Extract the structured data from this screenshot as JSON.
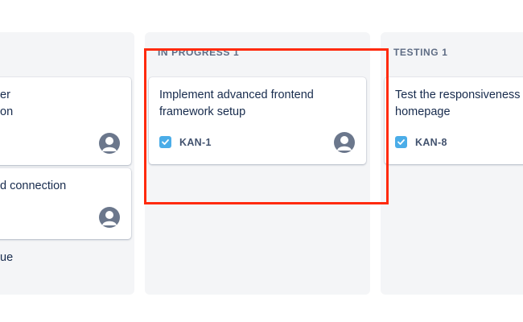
{
  "columns": {
    "left": {
      "cards": [
        {
          "title_line1": "er",
          "title_line2": "on"
        },
        {
          "title_line1": "d connection"
        }
      ],
      "trailing_text": "ue"
    },
    "in_progress": {
      "header": "IN PROGRESS",
      "count": "1",
      "card": {
        "title_line1": "Implement advanced frontend",
        "title_line2": "framework setup",
        "key": "KAN-1",
        "icon": "checkbox-icon"
      }
    },
    "testing": {
      "header": "TESTING",
      "count": "1",
      "card": {
        "title_line1": "Test the responsiveness",
        "title_line2": "homepage",
        "key": "KAN-8",
        "icon": "checkbox-icon"
      }
    }
  },
  "colors": {
    "highlight": "#ff2a0d",
    "column_bg": "#f4f5f7",
    "task_icon": "#4bade8",
    "avatar": "#6b778c"
  }
}
